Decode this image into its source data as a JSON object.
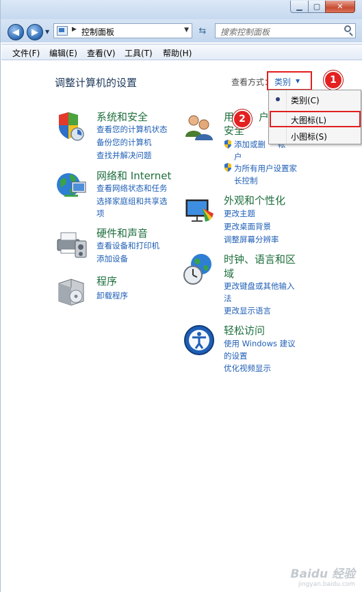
{
  "window": {
    "caption_min": "▁",
    "caption_max": "▢",
    "caption_close": "✕"
  },
  "nav": {
    "address": "控制面板",
    "address_sep": "▶",
    "search_placeholder": "搜索控制面板"
  },
  "menu": [
    "文件(F)",
    "编辑(E)",
    "查看(V)",
    "工具(T)",
    "帮助(H)"
  ],
  "main": {
    "title": "调整计算机的设置",
    "view_label": "查看方式：",
    "view_value": "类别",
    "callout_1": "1",
    "callout_2": "2"
  },
  "dropdown": {
    "items": [
      "类别(C)",
      "大图标(L)",
      "小图标(S)"
    ],
    "selected_index": 0,
    "highlighted_index": 1
  },
  "categories": {
    "system": {
      "title": "系统和安全",
      "links": [
        "查看您的计算机状态",
        "备份您的计算机",
        "查找并解决问题"
      ]
    },
    "network": {
      "title": "网络和 Internet",
      "links": [
        "查看网络状态和任务",
        "选择家庭组和共享选",
        "项"
      ]
    },
    "hardware": {
      "title": "硬件和声音",
      "links": [
        "查看设备和打印机",
        "添加设备"
      ]
    },
    "programs": {
      "title": "程序",
      "links": [
        "卸载程序"
      ]
    },
    "users": {
      "title_line1": "用",
      "title_line1b": "户",
      "title_line2": "安全",
      "links": [
        "添加或删",
        "帐",
        "户",
        "为所有用户设置家",
        "长控制"
      ]
    },
    "appearance": {
      "title": "外观和个性化",
      "links": [
        "更改主题",
        "更改桌面背景",
        "调整屏幕分辨率"
      ]
    },
    "clock": {
      "title_line1": "时钟、语言和区",
      "title_line2": "域",
      "links": [
        "更改键盘或其他输入",
        "法",
        "更改显示语言"
      ]
    },
    "access": {
      "title": "轻松访问",
      "links": [
        "使用 Windows 建议",
        "的设置",
        "优化视频显示"
      ]
    }
  },
  "watermark": {
    "brand": "Baidu 经验",
    "url": "jingyan.baidu.com"
  },
  "colors": {
    "link": "#1f5fb6",
    "category_title": "#1e6e3c",
    "highlight_box": "#e21e1e"
  }
}
